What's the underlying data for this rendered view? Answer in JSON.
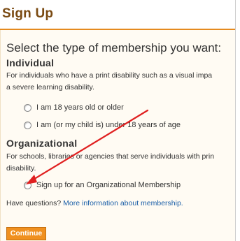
{
  "header": {
    "title": "Sign Up"
  },
  "main": {
    "heading": "Select the type of membership you want:",
    "individual": {
      "title": "Individual",
      "desc_line1": "For individuals who have a print disability such as a visual impa",
      "desc_line2": "a severe learning disability.",
      "options": [
        "I am 18 years old or older",
        "I am (or my child is) under 18 years of age"
      ]
    },
    "organizational": {
      "title": "Organizational",
      "desc_line1": "For schools, libraries or agencies that serve individuals with prin",
      "desc_line2": "disability.",
      "options": [
        "Sign up for an Organizational Membership"
      ]
    },
    "questions_text": "Have questions?",
    "questions_link": "More information about membership.",
    "continue_label": "Continue"
  },
  "colors": {
    "accent": "#f0901f",
    "title": "#7a4a12",
    "link": "#1b5fa8",
    "annotation_arrow": "#e02020"
  }
}
